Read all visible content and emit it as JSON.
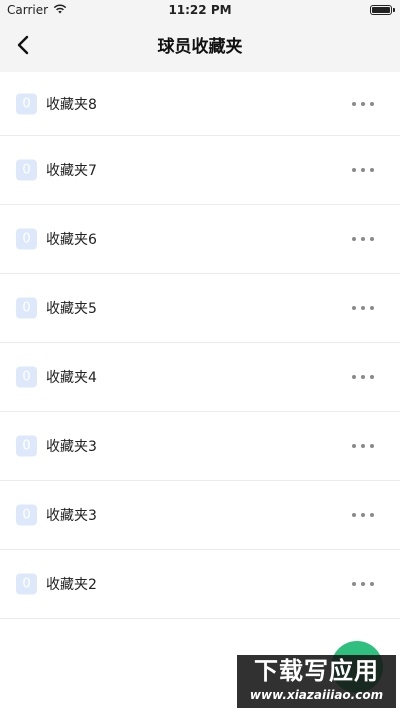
{
  "status_bar": {
    "carrier": "Carrier",
    "time": "11:22 PM"
  },
  "nav": {
    "title": "球员收藏夹",
    "back_icon": "chevron-left-icon"
  },
  "folders": [
    {
      "count": "0",
      "name": "收藏夹8"
    },
    {
      "count": "0",
      "name": "收藏夹7"
    },
    {
      "count": "0",
      "name": "收藏夹6"
    },
    {
      "count": "0",
      "name": "收藏夹5"
    },
    {
      "count": "0",
      "name": "收藏夹4"
    },
    {
      "count": "0",
      "name": "收藏夹3"
    },
    {
      "count": "0",
      "name": "收藏夹3"
    },
    {
      "count": "0",
      "name": "收藏夹2"
    }
  ],
  "watermark": {
    "main": "下载写应用",
    "sub": "www.xiazaiiiao.com"
  },
  "colors": {
    "accent_green": "#2fbf7e",
    "badge_bg": "#dde9fb",
    "bar_bg": "#f4f4f4"
  }
}
